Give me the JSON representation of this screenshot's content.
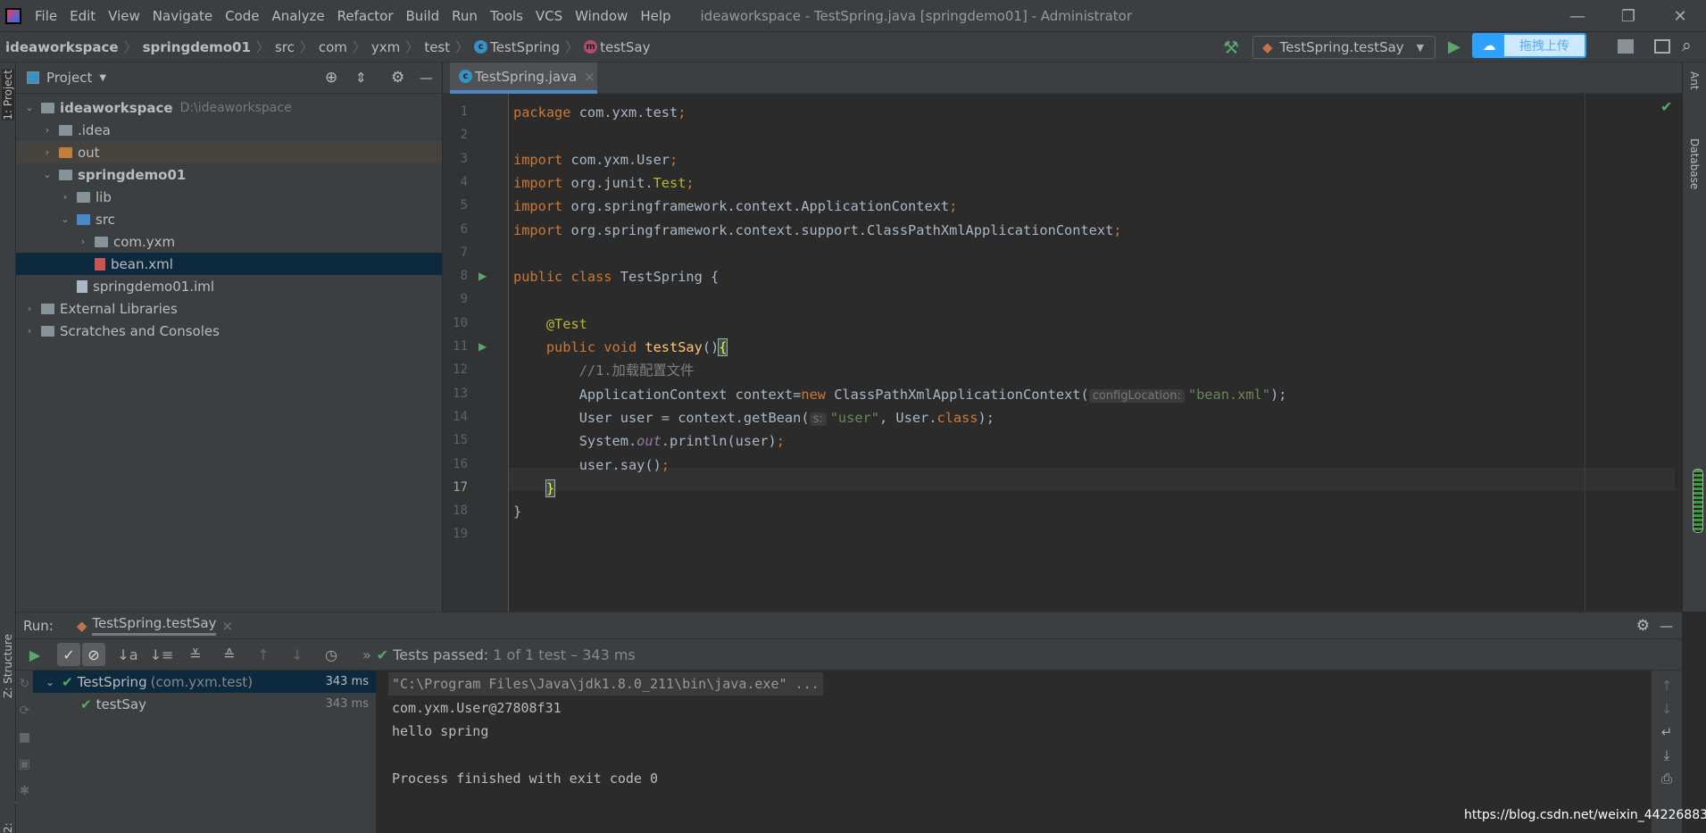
{
  "window": {
    "title": "ideaworkspace - TestSpring.java [springdemo01] - Administrator",
    "menu": [
      "File",
      "Edit",
      "View",
      "Navigate",
      "Code",
      "Analyze",
      "Refactor",
      "Build",
      "Run",
      "Tools",
      "VCS",
      "Window",
      "Help"
    ]
  },
  "breadcrumb": [
    "ideaworkspace",
    "springdemo01",
    "src",
    "com",
    "yxm",
    "test",
    "TestSpring",
    "testSay"
  ],
  "toolbar": {
    "run_config": "TestSpring.testSay",
    "baidu_upload": "拖拽上传"
  },
  "side_strips": {
    "left_top": "1: Project",
    "left_structure": "Z: Structure",
    "left_favorites": "2: Favorites",
    "right_ant": "Ant",
    "right_database": "Database"
  },
  "project": {
    "title": "Project",
    "items": [
      {
        "label": "ideaworkspace",
        "path": "D:\\ideaworkspace",
        "depth": 0,
        "expanded": true
      },
      {
        "label": ".idea",
        "depth": 1,
        "expanded": false
      },
      {
        "label": "out",
        "depth": 1,
        "expanded": false
      },
      {
        "label": "springdemo01",
        "depth": 1,
        "expanded": true
      },
      {
        "label": "lib",
        "depth": 2,
        "expanded": false
      },
      {
        "label": "src",
        "depth": 2,
        "expanded": true
      },
      {
        "label": "com.yxm",
        "depth": 3,
        "expanded": false
      },
      {
        "label": "bean.xml",
        "depth": 3
      },
      {
        "label": "springdemo01.iml",
        "depth": 2
      },
      {
        "label": "External Libraries",
        "depth": 0,
        "expanded": false
      },
      {
        "label": "Scratches and Consoles",
        "depth": 0,
        "expanded": false
      }
    ]
  },
  "editor": {
    "tab": "TestSpring.java",
    "current_line": 17,
    "lines": [
      [
        [
          "package ",
          "k"
        ],
        [
          "com.yxm.test",
          ""
        ],
        [
          ";",
          "k"
        ]
      ],
      [],
      [
        [
          "import ",
          "k"
        ],
        [
          "com.yxm.User",
          ""
        ],
        [
          ";",
          "k"
        ]
      ],
      [
        [
          "import ",
          "k"
        ],
        [
          "org.junit.",
          ""
        ],
        [
          "Test",
          "a"
        ],
        [
          ";",
          "k"
        ]
      ],
      [
        [
          "import ",
          "k"
        ],
        [
          "org.springframework.context.ApplicationContext",
          ""
        ],
        [
          ";",
          "k"
        ]
      ],
      [
        [
          "import ",
          "k"
        ],
        [
          "org.springframework.context.support.ClassPathXmlApplicationContext",
          ""
        ],
        [
          ";",
          "k"
        ]
      ],
      [],
      [
        [
          "public class ",
          "k"
        ],
        [
          "TestSpring {",
          ""
        ]
      ],
      [],
      [
        [
          "    ",
          ""
        ],
        [
          "@Test",
          "a"
        ]
      ],
      [
        [
          "    ",
          ""
        ],
        [
          "public void ",
          "k"
        ],
        [
          "testSay",
          "m"
        ],
        [
          "()",
          ""
        ],
        [
          "{",
          "brace"
        ]
      ],
      [
        [
          "        ",
          ""
        ],
        [
          "//1.加载配置文件",
          "c"
        ]
      ],
      [
        [
          "        ",
          ""
        ],
        [
          "ApplicationContext context=",
          ""
        ],
        [
          "new ",
          "k"
        ],
        [
          "ClassPathXmlApplicationContext(",
          ""
        ],
        [
          "configLocation:",
          "h"
        ],
        [
          "\"bean.xml\"",
          "s"
        ],
        [
          ");",
          ""
        ]
      ],
      [
        [
          "        ",
          ""
        ],
        [
          "User user = context.getBean(",
          ""
        ],
        [
          "s:",
          "h"
        ],
        [
          "\"user\"",
          "s"
        ],
        [
          ", User.",
          ""
        ],
        [
          "class",
          "k"
        ],
        [
          ");",
          ""
        ]
      ],
      [
        [
          "        ",
          ""
        ],
        [
          "System.",
          ""
        ],
        [
          "out",
          "st"
        ],
        [
          ".println(user)",
          ""
        ],
        [
          ";",
          "k"
        ]
      ],
      [
        [
          "        ",
          ""
        ],
        [
          "user.say()",
          ""
        ],
        [
          ";",
          "k"
        ]
      ],
      [
        [
          "    ",
          ""
        ],
        [
          "}",
          "brace"
        ]
      ],
      [
        [
          "}",
          ""
        ]
      ],
      []
    ]
  },
  "run": {
    "label": "Run:",
    "tab": "TestSpring.testSay",
    "status_prefix": "Tests passed:",
    "status_count": "1",
    "status_suffix": "of 1 test – 343 ms",
    "tree": [
      {
        "name": "TestSpring",
        "pkg": "(com.yxm.test)",
        "time": "343 ms"
      },
      {
        "name": "testSay",
        "time": "343 ms"
      }
    ],
    "console": [
      "\"C:\\Program Files\\Java\\jdk1.8.0_211\\bin\\java.exe\" ...",
      "com.yxm.User@27808f31",
      "hello spring",
      "",
      "Process finished with exit code 0"
    ]
  },
  "watermark": "https://blog.csdn.net/weixin_44226883"
}
